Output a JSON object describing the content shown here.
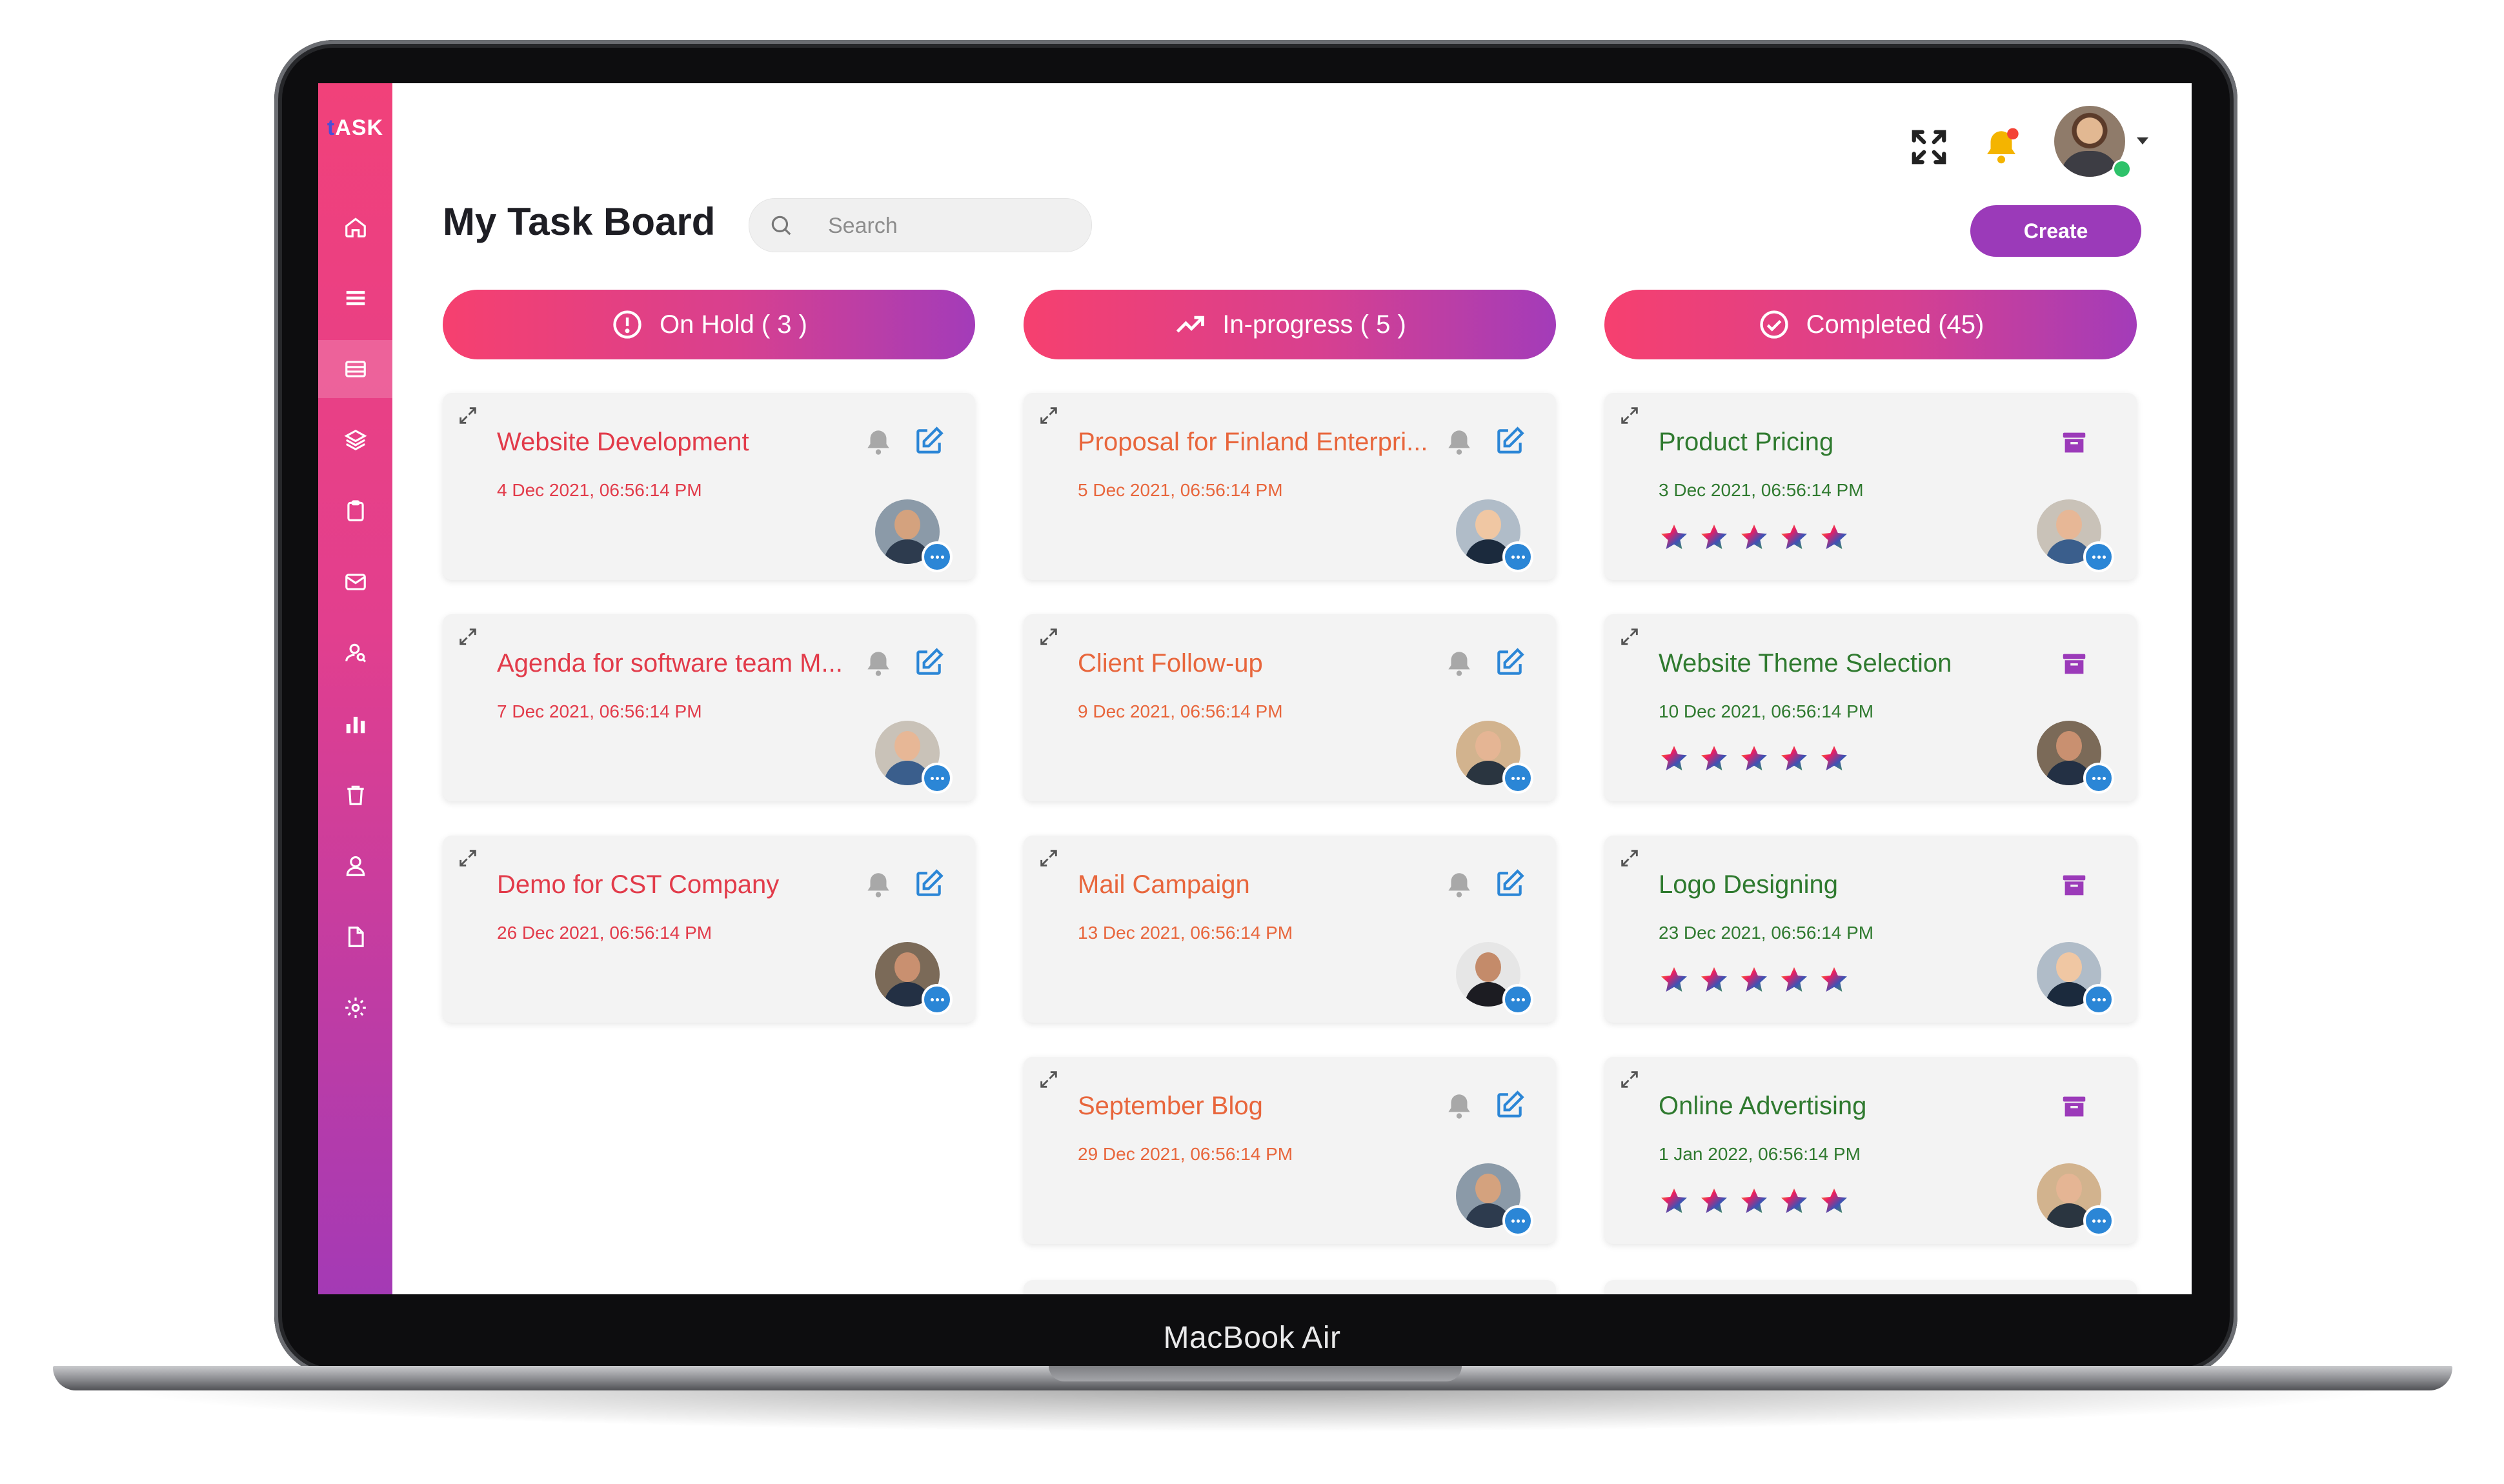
{
  "device": {
    "label": "MacBook Air"
  },
  "app": {
    "logo_text": "tASK",
    "title": "My Task Board"
  },
  "sidebar": {
    "items": [
      {
        "icon": "home-icon"
      },
      {
        "icon": "list-icon"
      },
      {
        "icon": "board-icon",
        "active": true
      },
      {
        "icon": "layers-icon"
      },
      {
        "icon": "clipboard-icon"
      },
      {
        "icon": "mail-icon"
      },
      {
        "icon": "contacts-icon"
      },
      {
        "icon": "bar-chart-icon"
      },
      {
        "icon": "trash-icon"
      },
      {
        "icon": "user-icon"
      },
      {
        "icon": "file-icon"
      },
      {
        "icon": "settings-icon"
      }
    ]
  },
  "header": {
    "search_placeholder": "Search",
    "create_label": "Create",
    "fullscreen_icon": "expand-icon",
    "notification_icon": "bell-icon",
    "notification_dot_color": "#f44336",
    "user_status": "online"
  },
  "columns": [
    {
      "key": "onhold",
      "label": "On Hold ( 3 )",
      "icon": "alert-circle-icon",
      "title_color": "#e23b4a",
      "cards": [
        {
          "title": "Website Development",
          "date": "4 Dec 2021, 06:56:14 PM"
        },
        {
          "title": "Agenda for software team M...",
          "date": "7 Dec 2021, 06:56:14 PM"
        },
        {
          "title": "Demo for CST Company",
          "date": "26 Dec 2021, 06:56:14 PM"
        }
      ]
    },
    {
      "key": "inprog",
      "label": "In-progress ( 5 )",
      "icon": "trending-up-icon",
      "title_color": "#e8663c",
      "cards": [
        {
          "title": "Proposal for Finland Enterpri...",
          "date": "5 Dec 2021, 06:56:14 PM"
        },
        {
          "title": "Client Follow-up",
          "date": "9 Dec 2021, 06:56:14 PM"
        },
        {
          "title": "Mail Campaign",
          "date": "13 Dec 2021, 06:56:14 PM"
        },
        {
          "title": "September Blog",
          "date": "29 Dec 2021, 06:56:14 PM"
        }
      ]
    },
    {
      "key": "done",
      "label": "Completed (45)",
      "icon": "check-circle-icon",
      "title_color": "#2f7a2f",
      "cards": [
        {
          "title": "Product Pricing",
          "date": "3 Dec 2021, 06:56:14 PM",
          "rating": 5
        },
        {
          "title": "Website Theme Selection",
          "date": "10 Dec 2021, 06:56:14 PM",
          "rating": 5
        },
        {
          "title": "Logo Designing",
          "date": "23 Dec 2021, 06:56:14 PM",
          "rating": 5
        },
        {
          "title": "Online Advertising",
          "date": "1 Jan 2022, 06:56:14 PM",
          "rating": 5
        }
      ]
    }
  ],
  "colors": {
    "accent": "#9b3ab9",
    "gradient_start": "#f6406f",
    "gradient_end": "#a33cb9"
  }
}
